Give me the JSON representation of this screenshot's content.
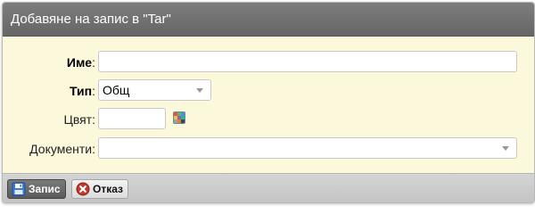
{
  "dialog": {
    "title": "Добавяне на запис в \"Tar\""
  },
  "form": {
    "name": {
      "label": "Име",
      "value": ""
    },
    "type": {
      "label": "Тип",
      "value": "Общ"
    },
    "color": {
      "label": "Цвят",
      "value": ""
    },
    "documents": {
      "label": "Документи",
      "value": ""
    },
    "colon": ":"
  },
  "buttons": {
    "save": "Запис",
    "cancel": "Отказ"
  },
  "icons": {
    "save": "floppy-disk-icon",
    "cancel": "cancel-circle-icon",
    "palette": "color-palette-icon",
    "dropdown": "chevron-down-icon"
  },
  "colors": {
    "form_bg": "#fbf8dc",
    "titlebar": "#6f6f6f",
    "cancel_red": "#c0392b",
    "save_blue": "#3a7bd5"
  }
}
